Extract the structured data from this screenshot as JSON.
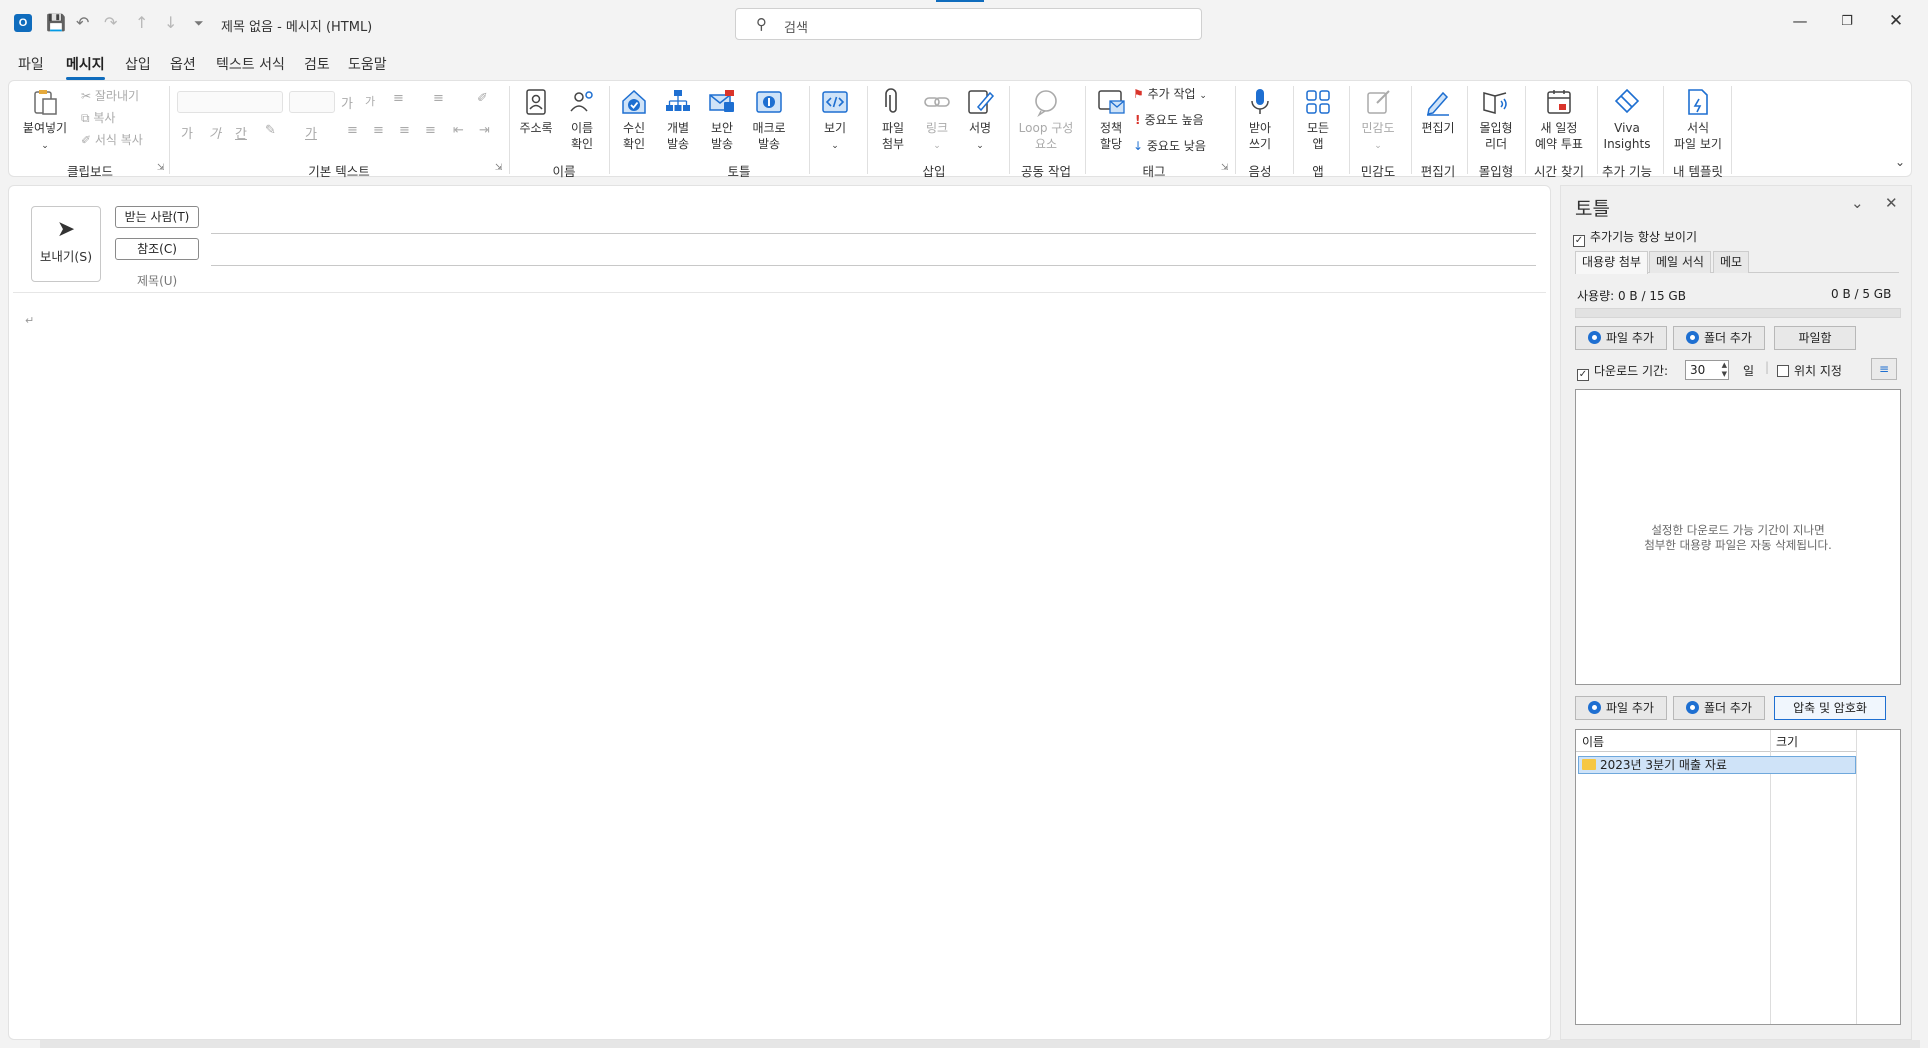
{
  "titlebar": {
    "app_icon": "O",
    "title": "제목 없음  -  메시지 (HTML)",
    "search_placeholder": "검색",
    "icons": [
      "save-icon",
      "undo-icon",
      "redo-icon",
      "arrow-up-icon",
      "arrow-down-icon",
      "customize-icon"
    ]
  },
  "menu": {
    "tabs": [
      "파일",
      "메시지",
      "삽입",
      "옵션",
      "텍스트 서식",
      "검토",
      "도움말"
    ],
    "active": "메시지"
  },
  "ribbon": {
    "clipboard": {
      "paste": "붙여넣기",
      "cut": "잘라내기",
      "copy": "복사",
      "format_painter": "서식 복사",
      "group": "클립보드"
    },
    "basic_text": {
      "bold": "가",
      "italic": "가",
      "underline": "간",
      "font_color": "가",
      "grow": "가",
      "shrink": "가",
      "group": "기본 텍스트"
    },
    "names": {
      "address_book": "주소록",
      "check_names_1": "이름",
      "check_names_2": "확인",
      "group": "이름"
    },
    "tools": {
      "receipt_1": "수신",
      "receipt_2": "확인",
      "individual_1": "개별",
      "individual_2": "발송",
      "secure_1": "보안",
      "secure_2": "발송",
      "macro_1": "매크로",
      "macro_2": "발송",
      "group": "토틀"
    },
    "view": {
      "label": "보기"
    },
    "insert": {
      "attach_1": "파일",
      "attach_2": "첨부",
      "link": "링크",
      "signature": "서명",
      "group": "삽입"
    },
    "collab": {
      "loop_1": "Loop 구성",
      "loop_2": "요소",
      "group": "공동 작업"
    },
    "tags": {
      "policy_1": "정책",
      "policy_2": "할당",
      "followup": "추가 작업",
      "high": "중요도 높음",
      "low": "중요도 낮음",
      "group": "태그"
    },
    "voice": {
      "dictate_1": "받아",
      "dictate_2": "쓰기",
      "group": "음성"
    },
    "apps": {
      "all_1": "모든",
      "all_2": "앱",
      "group": "앱"
    },
    "sensitivity": {
      "label": "민감도",
      "group": "민감도"
    },
    "editor": {
      "label": "편집기",
      "group": "편집기"
    },
    "immersive": {
      "label_1": "몰입형",
      "label_2": "리더",
      "group": "몰입형"
    },
    "scheduling": {
      "label_1": "새 일정",
      "label_2": "예약 투표",
      "group": "시간 찾기"
    },
    "addins": {
      "label_1": "Viva",
      "label_2": "Insights",
      "group": "추가 기능"
    },
    "templates": {
      "label_1": "서식",
      "label_2": "파일 보기",
      "group": "내 템플릿"
    }
  },
  "compose": {
    "send": "보내기(S)",
    "to": "받는 사람(T)",
    "cc": "참조(C)",
    "subject": "제목(U)",
    "para_mark": "↵"
  },
  "pane": {
    "title": "토틀",
    "always_show": "추가기능 항상 보이기",
    "tabs": [
      "대용량 첨부",
      "메일 서식",
      "메모"
    ],
    "usage_left": "사용량: 0 B / 15 GB",
    "usage_right": "0 B / 5 GB",
    "add_file": "파일 추가",
    "add_folder": "폴더 추가",
    "file_box": "파일함",
    "download_period": "다운로드 기간:",
    "days_value": "30",
    "days_unit": "일",
    "location": "위치 지정",
    "drop_msg_1": "설정한 다운로드 가능 기간이 지나면",
    "drop_msg_2": "첨부한 대용량 파일은 자동 삭제됩니다.",
    "compress": "압축 및 암호화",
    "col_name": "이름",
    "col_size": "크기",
    "files": [
      {
        "name": "2023년 3분기 매출 자료",
        "size": ""
      }
    ]
  },
  "colors": {
    "accent": "#0f6cbd",
    "radio": "#1e6fd1",
    "selection": "#cfe3f8"
  }
}
